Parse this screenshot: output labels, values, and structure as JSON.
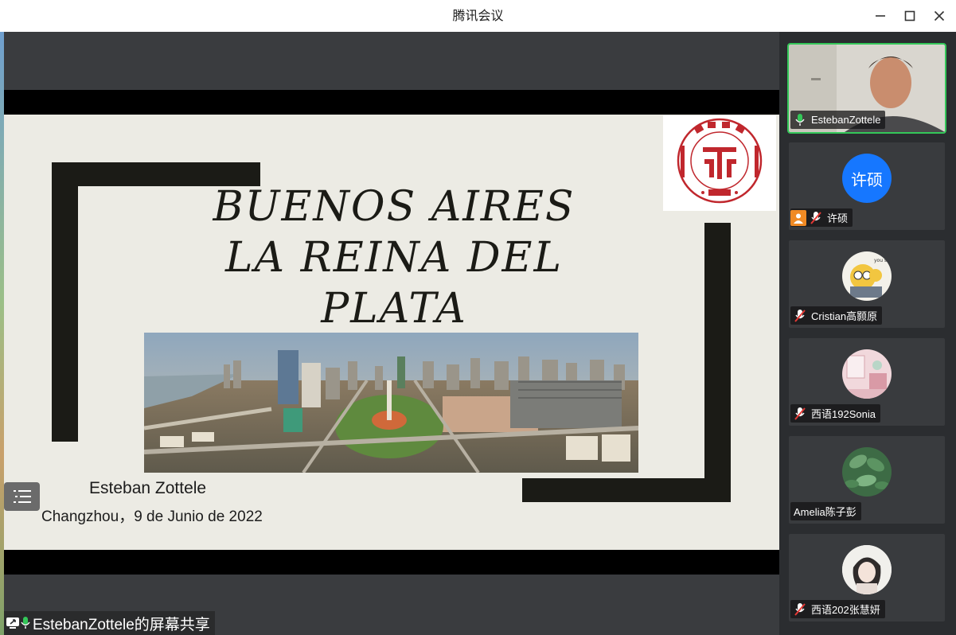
{
  "window": {
    "title": "腾讯会议"
  },
  "slide": {
    "title_lines": [
      "BUENOS AIRES",
      "LA REINA DEL",
      "PLATA"
    ],
    "author": "Esteban Zottele",
    "place_date": "Changzhou，9 de Junio de 2022",
    "logo": {
      "arc_text": "常州大学",
      "side_text_left": "CHANGZHOU",
      "side_text_right": "UNIVERSITY",
      "year": "1978"
    }
  },
  "share_bar": {
    "label": "EstebanZottele的屏幕共享"
  },
  "participants": [
    {
      "name": "EstebanZottele",
      "type": "video",
      "mic": "on",
      "active": true
    },
    {
      "name": "许硕",
      "type": "initials",
      "initials": "许硕",
      "mic": "muted",
      "avatar_color": "#1677ff",
      "has_user_badge": true
    },
    {
      "name": "Cristian高颢原",
      "type": "avatar",
      "mic": "muted",
      "avatar_art": "cartoon-emoji",
      "avatar_caption": "you sa"
    },
    {
      "name": "西语192Sonia",
      "type": "avatar",
      "mic": "muted",
      "avatar_art": "pink-room"
    },
    {
      "name": "Amelia陈子彭",
      "type": "avatar",
      "mic": "none",
      "avatar_art": "green-leaves"
    },
    {
      "name": "西语202张慧妍",
      "type": "avatar",
      "mic": "muted",
      "avatar_art": "sketch-girl"
    }
  ],
  "colors": {
    "mic_on": "#34c759",
    "active_border": "#34c759",
    "initials_avatar": "#1677ff",
    "user_badge": "#f08a24",
    "slide_bg": "#ecebe4",
    "deco": "#1b1b16",
    "logo_red": "#c0272d"
  }
}
